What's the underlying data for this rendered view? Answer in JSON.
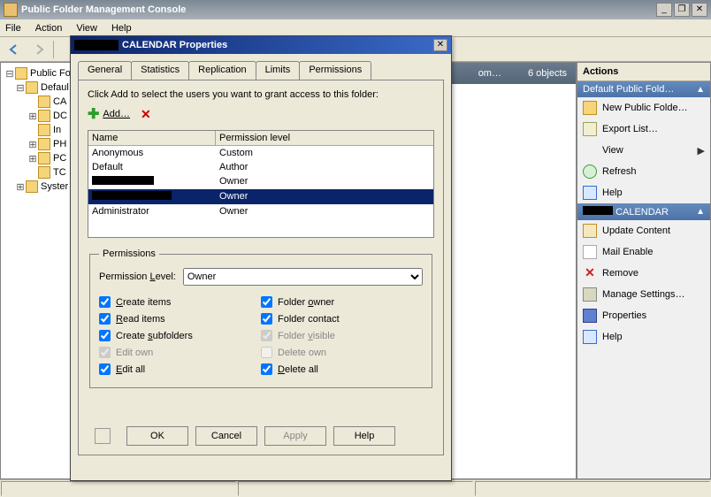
{
  "app": {
    "title": "Public Folder Management Console",
    "window_controls": {
      "minimize": "_",
      "restore": "❐",
      "close": "✕"
    }
  },
  "menubar": [
    "File",
    "Action",
    "View",
    "Help"
  ],
  "tree": {
    "root": "Public Fold",
    "default_node": "Defaul",
    "items": [
      "CA",
      "DC",
      "In",
      "PH",
      "PC",
      "TC"
    ],
    "system_node": "Syster"
  },
  "middle": {
    "header_text1": "om…",
    "header_text2": "6 objects"
  },
  "actions": {
    "header": "Actions",
    "section1": {
      "title": "Default Public Fold…"
    },
    "items1": [
      {
        "icon": "folder",
        "label": "New Public Folde…"
      },
      {
        "icon": "list",
        "label": "Export List…"
      },
      {
        "icon": "",
        "label": "View",
        "arrow": true
      },
      {
        "icon": "refresh",
        "label": "Refresh"
      },
      {
        "icon": "help",
        "label": "Help"
      }
    ],
    "section2": {
      "title_suffix": "CALENDAR"
    },
    "items2": [
      {
        "icon": "update",
        "label": "Update Content"
      },
      {
        "icon": "mail",
        "label": "Mail Enable"
      },
      {
        "icon": "remove",
        "label": "Remove"
      },
      {
        "icon": "gear",
        "label": "Manage Settings…"
      },
      {
        "icon": "prop",
        "label": "Properties"
      },
      {
        "icon": "help",
        "label": "Help"
      }
    ]
  },
  "dialog": {
    "title_suffix": "CALENDAR Properties",
    "tabs": [
      "General",
      "Statistics",
      "Replication",
      "Limits",
      "Permissions"
    ],
    "active_tab": 4,
    "instruction": "Click Add to select the users you want to grant access to this folder:",
    "add_label": "Add…",
    "list": {
      "columns": [
        "Name",
        "Permission level"
      ],
      "rows": [
        {
          "name": "Anonymous",
          "level": "Custom",
          "redacted": false,
          "selected": false
        },
        {
          "name": "Default",
          "level": "Author",
          "redacted": false,
          "selected": false
        },
        {
          "name": "",
          "level": "Owner",
          "redacted": true,
          "redact_w": 70,
          "selected": false
        },
        {
          "name": "",
          "level": "Owner",
          "redacted": true,
          "redact_w": 90,
          "selected": true
        },
        {
          "name": "Administrator",
          "level": "Owner",
          "redacted": false,
          "selected": false
        }
      ]
    },
    "permissions_legend": "Permissions",
    "level_label": "Permission Level:",
    "level_value": "Owner",
    "checks_left": [
      {
        "label": "Create items",
        "checked": true,
        "disabled": false,
        "ul": "C"
      },
      {
        "label": "Read items",
        "checked": true,
        "disabled": false,
        "ul": "R"
      },
      {
        "label": "Create subfolders",
        "checked": true,
        "disabled": false,
        "ul_idx": 7
      },
      {
        "label": "Edit own",
        "checked": true,
        "disabled": true
      },
      {
        "label": "Edit all",
        "checked": true,
        "disabled": false,
        "ul": "E"
      }
    ],
    "checks_right": [
      {
        "label": "Folder owner",
        "checked": true,
        "disabled": false,
        "ul": "o",
        "ul_idx": 7
      },
      {
        "label": "Folder contact",
        "checked": true,
        "disabled": false
      },
      {
        "label": "Folder visible",
        "checked": true,
        "disabled": true,
        "ul": "v",
        "ul_idx": 7
      },
      {
        "label": "Delete own",
        "checked": false,
        "disabled": true
      },
      {
        "label": "Delete all",
        "checked": true,
        "disabled": false,
        "ul": "D"
      }
    ],
    "buttons": {
      "ok": "OK",
      "cancel": "Cancel",
      "apply": "Apply",
      "help": "Help"
    }
  }
}
